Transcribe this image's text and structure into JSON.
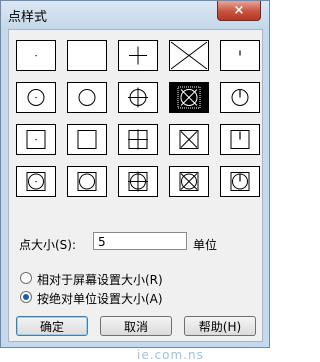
{
  "window": {
    "title": "点样式",
    "close_glyph": "×"
  },
  "grid": [
    [
      "dot",
      "blank",
      "plus",
      "x",
      "tick"
    ],
    [
      "circle-dot",
      "circle",
      "circle-plus",
      "circle-x",
      "circle-tick"
    ],
    [
      "square-dot",
      "square",
      "square-plus",
      "square-x",
      "square-tick"
    ],
    [
      "sqcircle-dot",
      "sqcircle",
      "sqcircle-plus",
      "sqcircle-x",
      "sqcircle-tick"
    ]
  ],
  "selected": "circle-x",
  "size": {
    "label": "点大小(S):",
    "value": "5",
    "unit": "单位"
  },
  "options": [
    {
      "label": "相对于屏幕设置大小(R)",
      "checked": false
    },
    {
      "label": "按绝对单位设置大小(A)",
      "checked": true
    }
  ],
  "buttons": {
    "ok": "确定",
    "cancel": "取消",
    "help": "帮助(H)"
  },
  "colors": {
    "accent": "#1b5fb0",
    "titlebar": "#c6d9ec",
    "close": "#c9523d"
  },
  "watermark": "ie.com.ns"
}
